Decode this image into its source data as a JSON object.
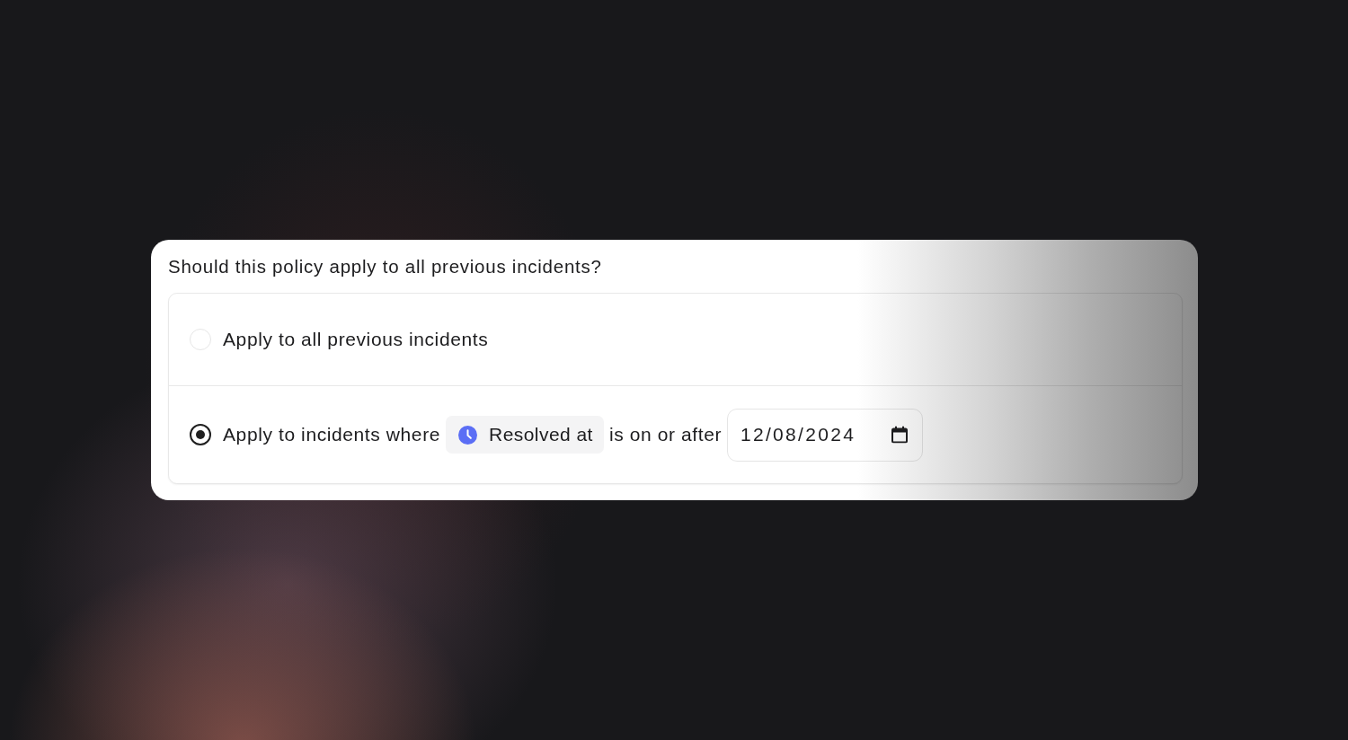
{
  "question": "Should this policy apply to all previous incidents?",
  "options": [
    {
      "kind": "plain",
      "label": "Apply to all previous incidents",
      "selected": false
    },
    {
      "kind": "condition",
      "label": "Apply to incidents where",
      "field": "Resolved at",
      "operator": "is on or after",
      "date": "12/08/2024",
      "selected": true
    }
  ]
}
